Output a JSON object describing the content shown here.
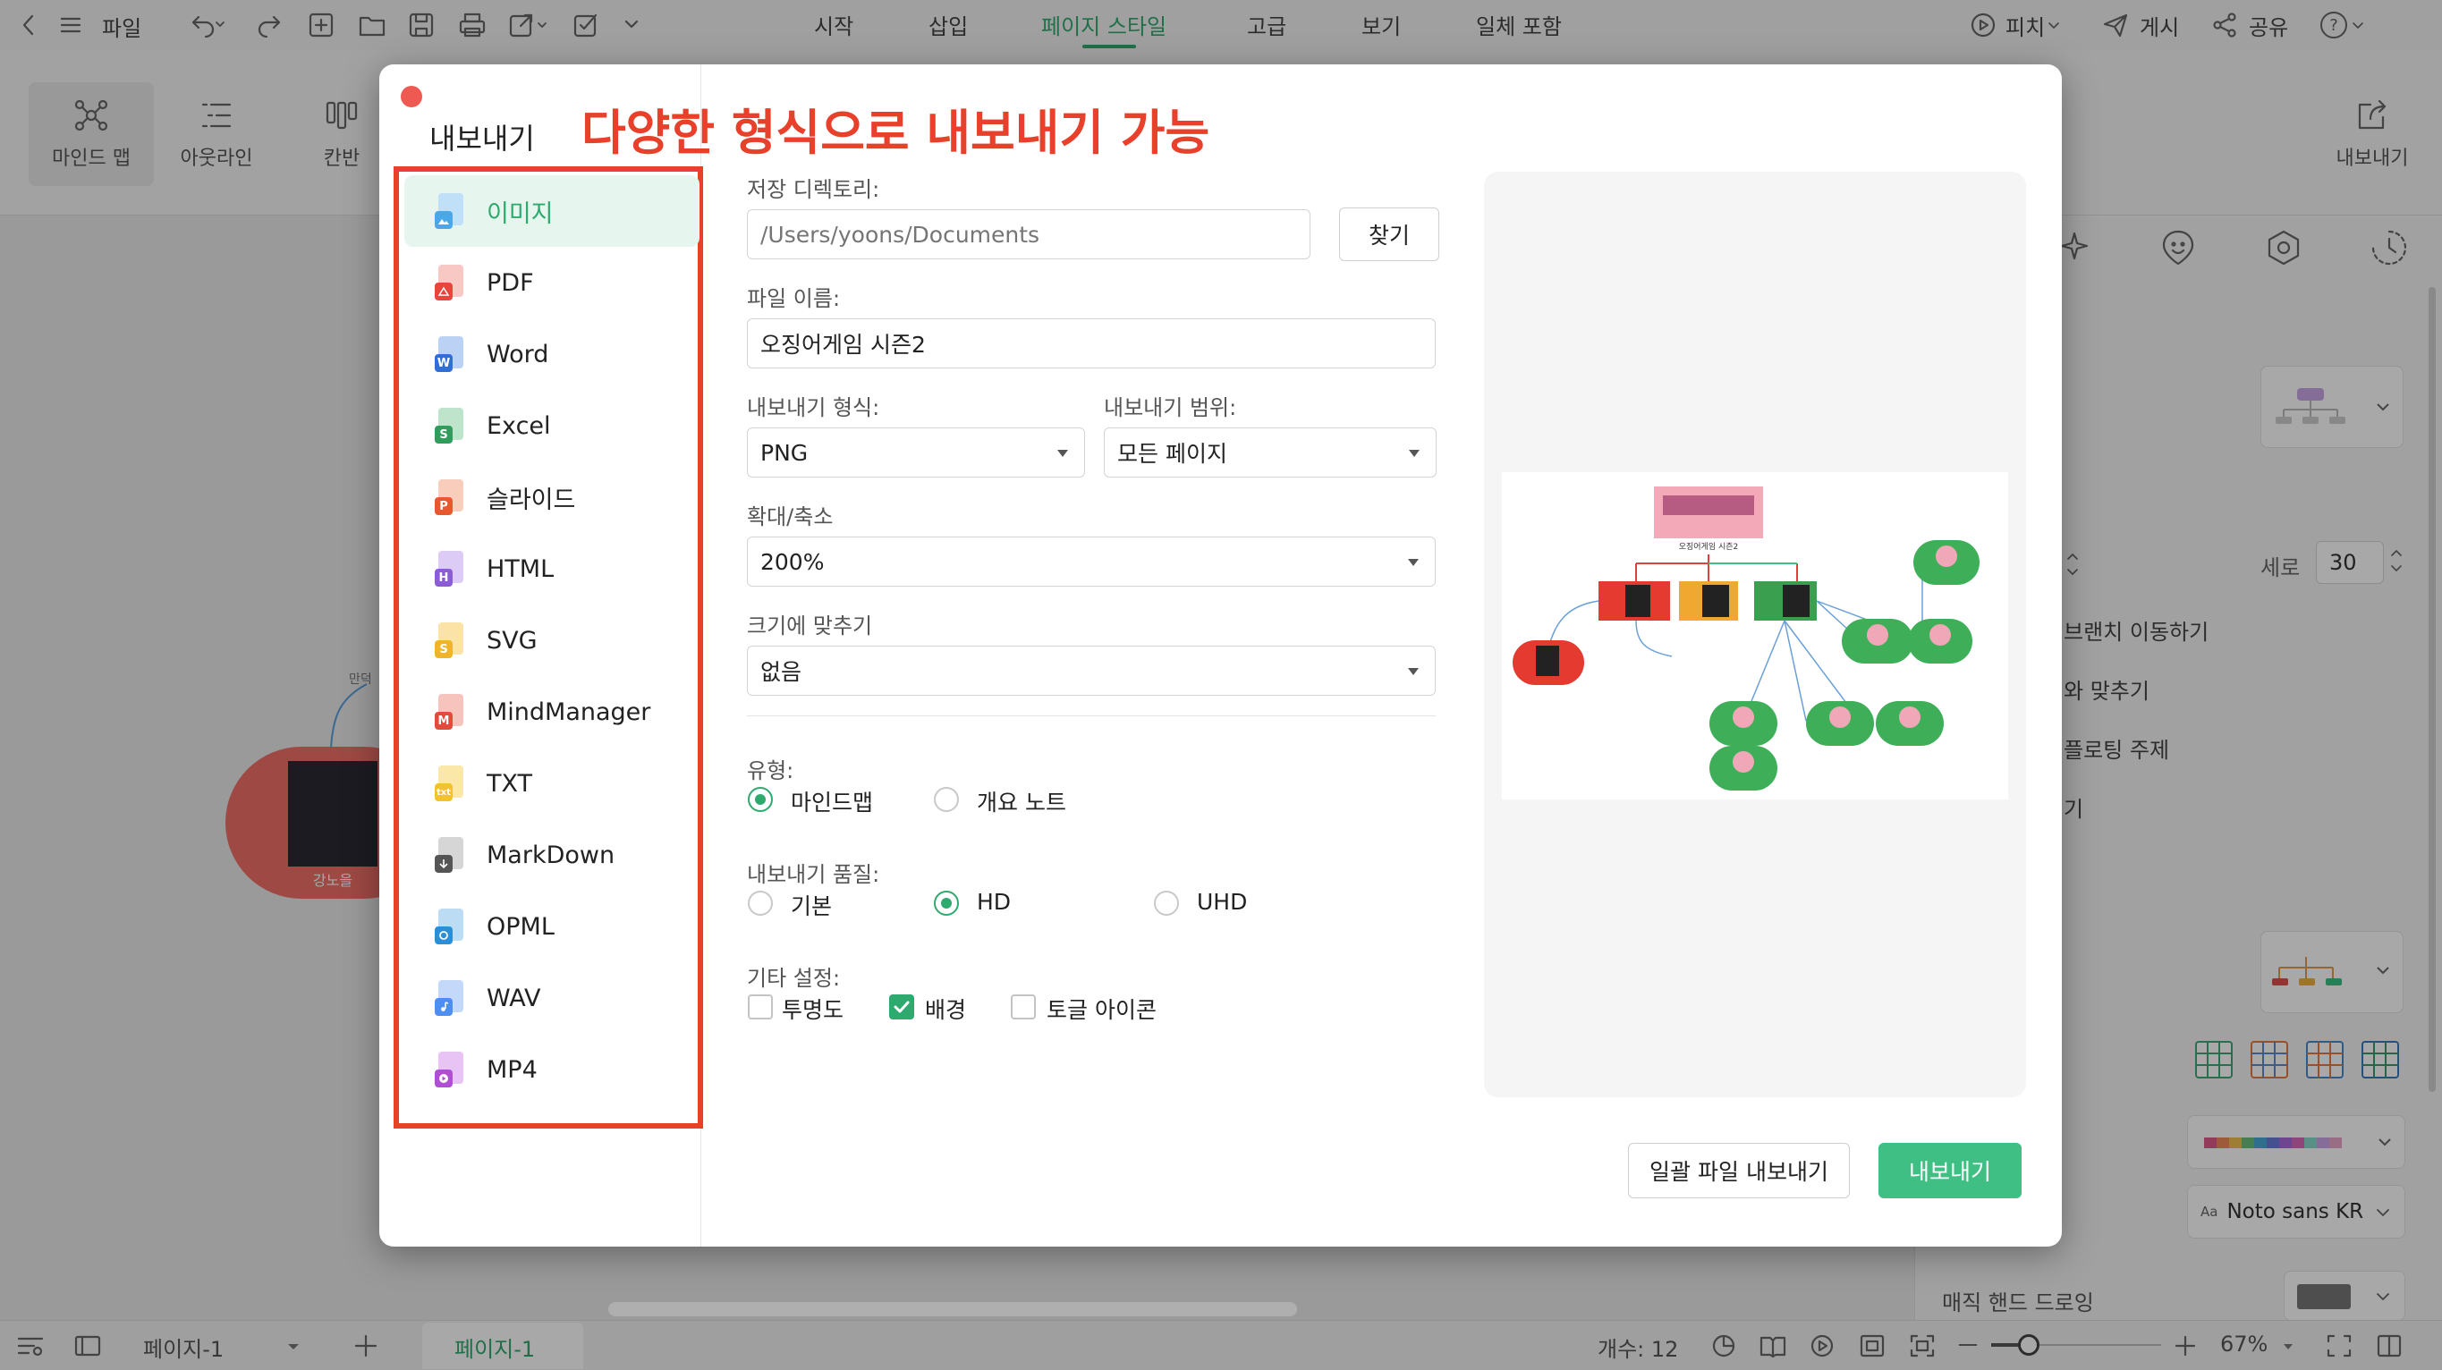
{
  "topbar": {
    "file_menu": "파일",
    "tabs": [
      "시작",
      "삽입",
      "페이지 스타일",
      "고급",
      "보기",
      "일체 포함"
    ],
    "active_tab": "페이지 스타일",
    "pitch": "피치",
    "publish": "게시",
    "share": "공유",
    "help": "?"
  },
  "ribbon": {
    "mindmap": "마인드 맵",
    "outline": "아웃라인",
    "kanban": "칸반",
    "export": "내보내기"
  },
  "canvas": {
    "node_label": "강노을",
    "edge_label": "만덕"
  },
  "right_panel": {
    "vertical_label": "세로",
    "vertical_value": "30",
    "branch_move": "브랜치 이동하기",
    "fit_label": "와 맞추기",
    "floating_topic": "플로팅 주제",
    "item4": "기",
    "font_name": "Noto sans KR",
    "magic_draw": "매직 핸드 드로잉",
    "accent_color": "#3fbf84"
  },
  "statusbar": {
    "page_selector": "페이지-1",
    "page_tab": "페이지-1",
    "count": "개수: 12",
    "zoom": "67%"
  },
  "dialog": {
    "title": "내보내기",
    "annotation": "다양한 형식으로 내보내기 가능",
    "formats": [
      {
        "label": "이미지",
        "badge": "",
        "color": "#4aa8e8"
      },
      {
        "label": "PDF",
        "badge": "",
        "color": "#e8453c"
      },
      {
        "label": "Word",
        "badge": "W",
        "color": "#2f6fd6"
      },
      {
        "label": "Excel",
        "badge": "S",
        "color": "#2f9d5b"
      },
      {
        "label": "슬라이드",
        "badge": "P",
        "color": "#e8582f"
      },
      {
        "label": "HTML",
        "badge": "H",
        "color": "#8b5cd6"
      },
      {
        "label": "SVG",
        "badge": "S",
        "color": "#f0b429"
      },
      {
        "label": "MindManager",
        "badge": "M",
        "color": "#e24a3b"
      },
      {
        "label": "TXT",
        "badge": "txt",
        "color": "#f2c230"
      },
      {
        "label": "MarkDown",
        "badge": "",
        "color": "#555555"
      },
      {
        "label": "OPML",
        "badge": "",
        "color": "#2a8fd6"
      },
      {
        "label": "WAV",
        "badge": "",
        "color": "#4d8ff0"
      },
      {
        "label": "MP4",
        "badge": "",
        "color": "#b04fd6"
      }
    ],
    "active_format": "이미지",
    "save_dir_label": "저장 디렉토리:",
    "save_dir_placeholder": "/Users/yoons/Documents",
    "browse": "찾기",
    "filename_label": "파일 이름:",
    "filename_value": "오징어게임 시즌2",
    "format_label": "내보내기 형식:",
    "format_value": "PNG",
    "range_label": "내보내기 범위:",
    "range_value": "모든 페이지",
    "zoom_label": "확대/축소",
    "zoom_value": "200%",
    "fit_label": "크기에 맞추기",
    "fit_value": "없음",
    "type_label": "유형:",
    "type_options": [
      "마인드맵",
      "개요 노트"
    ],
    "type_selected": "마인드맵",
    "quality_label": "내보내기 품질:",
    "quality_options": [
      "기본",
      "HD",
      "UHD"
    ],
    "quality_selected": "HD",
    "other_label": "기타 설정:",
    "checkboxes": [
      {
        "label": "투명도",
        "checked": false
      },
      {
        "label": "배경",
        "checked": true
      },
      {
        "label": "토글 아이콘",
        "checked": false
      }
    ],
    "batch_export": "일괄 파일 내보내기",
    "export": "내보내기",
    "preview_title": "오징어게임 시즌2"
  }
}
